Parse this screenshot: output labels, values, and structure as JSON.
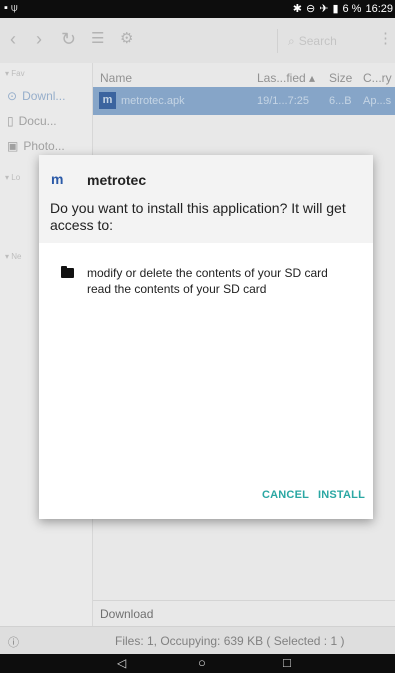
{
  "status_bar": {
    "battery_percent": "6 %",
    "time": "16:29"
  },
  "toolbar": {
    "search_placeholder": "Search"
  },
  "sidebar": {
    "header_fav": "Fav",
    "header_local": "Lo",
    "header_network": "Ne",
    "items": [
      {
        "label": "Downl..."
      },
      {
        "label": "Docu..."
      },
      {
        "label": "Photo..."
      }
    ]
  },
  "file_list": {
    "columns": [
      "Name",
      "Las...fied",
      "Size",
      "C...ry"
    ],
    "rows": [
      {
        "name": "metrotec.apk",
        "modified": "19/1...7:25",
        "size": "6...B",
        "category": "Ap...s"
      }
    ]
  },
  "path_bar": {
    "path": "Download"
  },
  "info_bar": {
    "text": "Files: 1, Occupying: 639 KB ( Selected : 1 )"
  },
  "dialog": {
    "app_name": "metrotec",
    "question": "Do you want to install this application? It will get access to:",
    "permissions": [
      "modify or delete the contents of your SD card",
      "read the contents of your SD card"
    ],
    "cancel_label": "CANCEL",
    "install_label": "INSTALL",
    "accent_color": "#2aa7a3"
  }
}
